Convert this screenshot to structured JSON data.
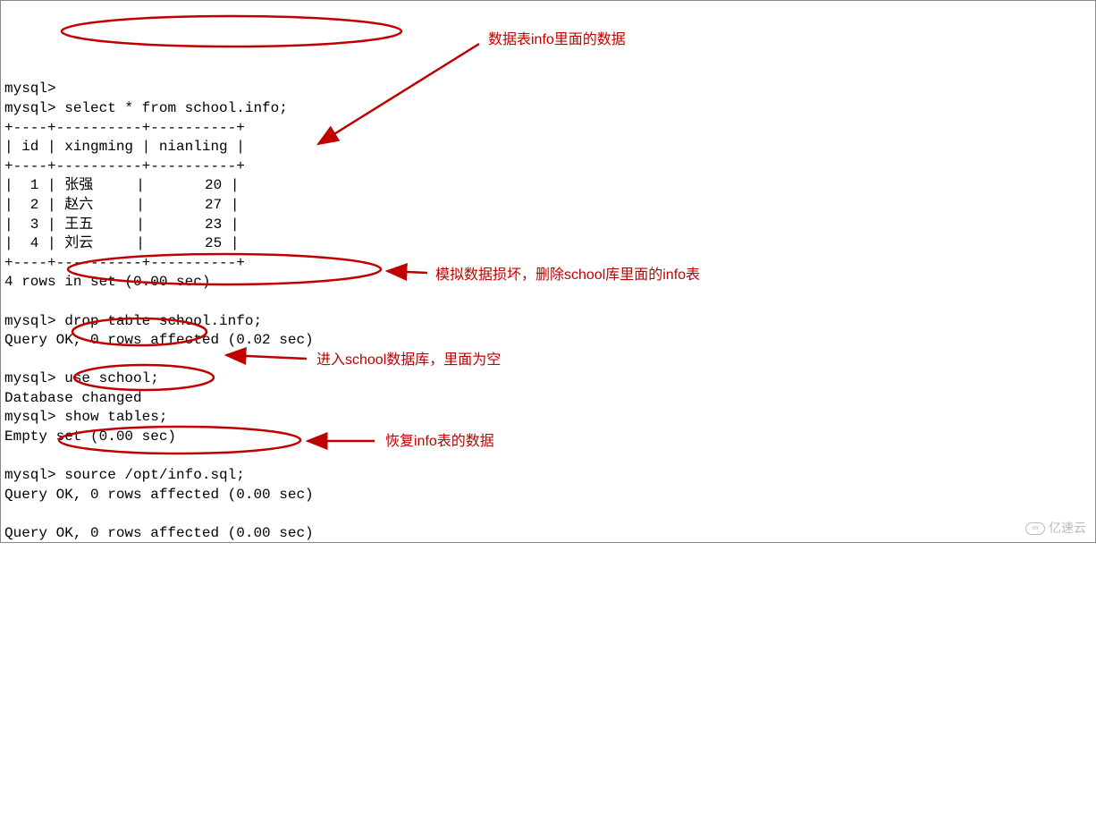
{
  "prompt": "mysql>",
  "commands": {
    "select": "select * from school.info;",
    "drop": "drop table school.info;",
    "use": "use school;",
    "show": "show tables;",
    "source": "source /opt/info.sql;"
  },
  "table": {
    "border_top": "+----+----------+----------+",
    "header": "| id | xingming | nianling |",
    "rows": [
      "|  1 | 张强     |       20 |",
      "|  2 | 赵六     |       27 |",
      "|  3 | 王五     |       23 |",
      "|  4 | 刘云     |       25 |"
    ]
  },
  "results": {
    "rows_in_set": "4 rows in set (0.00 sec)",
    "query_ok_002": "Query OK, 0 rows affected (0.02 sec)",
    "db_changed": "Database changed",
    "empty_set": "Empty set (0.00 sec)",
    "query_ok_000": "Query OK, 0 rows affected (0.00 sec)"
  },
  "annotations": {
    "a1": "数据表info里面的数据",
    "a2": "模拟数据损坏，删除school库里面的info表",
    "a3": "进入school数据库，里面为空",
    "a4": "恢复info表的数据"
  },
  "watermark": "亿速云"
}
